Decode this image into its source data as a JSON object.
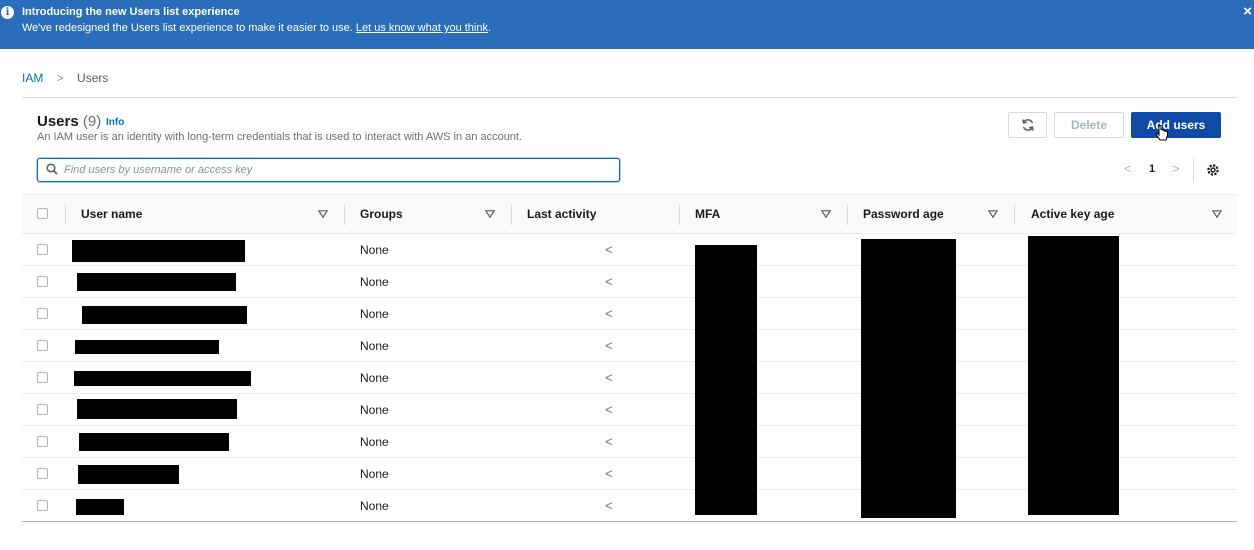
{
  "banner": {
    "title": "Introducing the new Users list experience",
    "text": "We've redesigned the Users list experience to make it easier to use.",
    "link": "Let us know what you think",
    "trailing": ".",
    "close": "×"
  },
  "breadcrumb": {
    "root": "IAM",
    "separator": ">",
    "current": "Users"
  },
  "header": {
    "title": "Users",
    "count": "(9)",
    "info": "Info",
    "description": "An IAM user is an identity with long-term credentials that is used to interact with AWS in an account."
  },
  "buttons": {
    "refresh_icon": "refresh-icon",
    "delete": "Delete",
    "add": "Add users"
  },
  "search": {
    "placeholder": "Find users by username or access key",
    "value": ""
  },
  "pagination": {
    "prev": "<",
    "page": "1",
    "next": ">"
  },
  "table": {
    "columns": [
      "User name",
      "Groups",
      "Last activity",
      "MFA",
      "Password age",
      "Active key age"
    ],
    "rows": [
      {
        "groups": "None",
        "activity": "<"
      },
      {
        "groups": "None",
        "activity": "<"
      },
      {
        "groups": "None",
        "activity": "<"
      },
      {
        "groups": "None",
        "activity": "<"
      },
      {
        "groups": "None",
        "activity": "<"
      },
      {
        "groups": "None",
        "activity": "<"
      },
      {
        "groups": "None",
        "activity": "<"
      },
      {
        "groups": "None",
        "activity": "<"
      },
      {
        "groups": "None",
        "activity": "<"
      }
    ]
  },
  "colors": {
    "banner": "#2a6ebb",
    "primary_button": "#0f4ba6",
    "link": "#0073bb",
    "redaction": "#000000"
  }
}
